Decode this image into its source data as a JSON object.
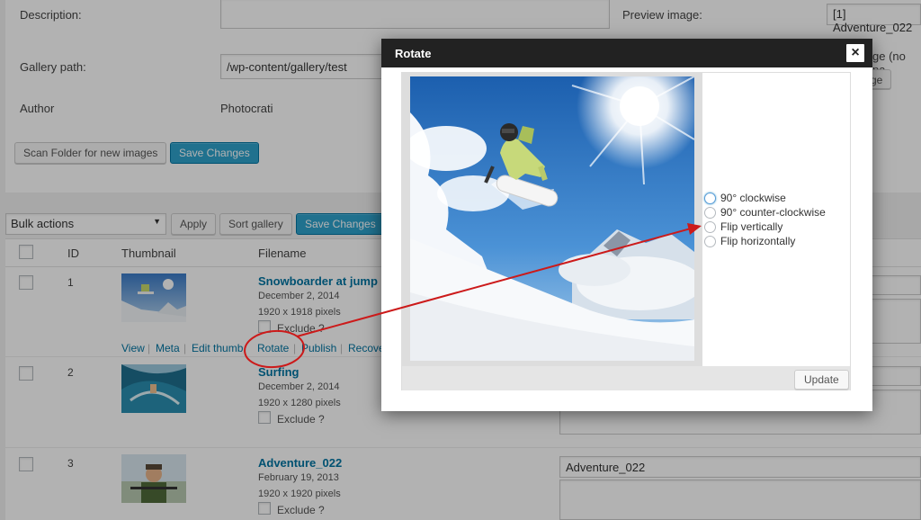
{
  "settings": {
    "description_label": "Description:",
    "gallery_path_label": "Gallery path:",
    "gallery_path_value": "/wp-content/gallery/test",
    "author_label": "Author",
    "author_value": "Photocrati",
    "preview_label": "Preview image:",
    "preview_value": "[1] Adventure_022",
    "preview_image_label": "ge (no pa",
    "change_button": "ge",
    "scan_button": "Scan Folder for new images",
    "save_button": "Save Changes"
  },
  "toolbar": {
    "bulk_actions": "Bulk actions",
    "apply": "Apply",
    "sort_gallery": "Sort gallery",
    "save_changes": "Save Changes"
  },
  "table": {
    "col_id": "ID",
    "col_thumbnail": "Thumbnail",
    "col_filename": "Filename",
    "rows": [
      {
        "id": "1",
        "title": "Snowboarder at jump in",
        "date": "December 2, 2014",
        "dims": "1920 x 1918 pixels",
        "exclude": "Exclude ?"
      },
      {
        "id": "2",
        "title": "Surfing",
        "date": "December 2, 2014",
        "dims": "1920 x 1280 pixels",
        "exclude": "Exclude ?"
      },
      {
        "id": "3",
        "title": "Adventure_022",
        "date": "February 19, 2013",
        "dims": "1920 x 1920 pixels",
        "exclude": "Exclude ?",
        "alt_text": "Adventure_022"
      }
    ],
    "row_actions": [
      "View",
      "Meta",
      "Edit thumb",
      "Rotate",
      "Publish",
      "Recove"
    ]
  },
  "modal": {
    "title": "Rotate",
    "close": "×",
    "options": [
      "90° clockwise",
      "90° counter-clockwise",
      "Flip vertically",
      "Flip horizontally"
    ],
    "update": "Update"
  },
  "colors": {
    "accent": "#2ea2cc",
    "link": "#0074a2",
    "annotation": "#cc1a1a",
    "modal_header": "#222222"
  }
}
